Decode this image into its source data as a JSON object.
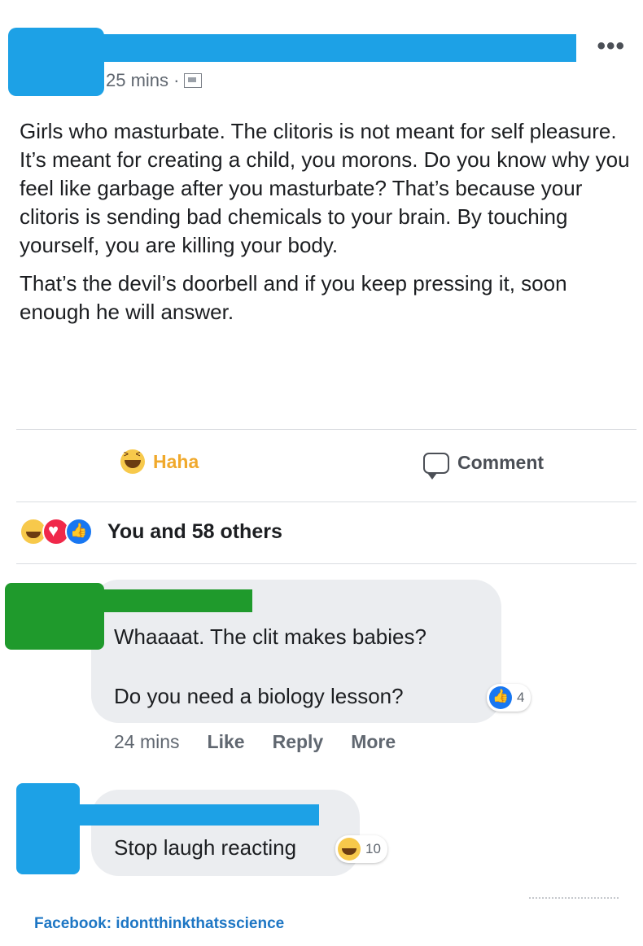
{
  "post": {
    "timestamp": "25 mins ·",
    "privacy_icon": "public-globe-icon",
    "more_icon": "more-dots-icon",
    "paragraphs": [
      "Girls who masturbate. The clitoris is not meant for self pleasure. It’s meant for creating a child, you morons. Do you know why you feel like garbage after you masturbate? That’s because your clitoris is sending bad chemicals to your brain. By touching yourself, you are killing your body.",
      "That’s the devil’s doorbell and if you keep pressing it, soon enough he will answer."
    ]
  },
  "actions": {
    "haha_label": "Haha",
    "comment_label": "Comment"
  },
  "reactions": {
    "summary": "You and 58 others",
    "icons": [
      "haha-icon",
      "love-icon",
      "like-icon"
    ]
  },
  "comments": [
    {
      "lines": [
        "Whaaaat. The clit makes babies?",
        "Do you need a biology lesson?"
      ],
      "reaction_count": "4",
      "time": "24 mins",
      "like": "Like",
      "reply": "Reply",
      "more": "More"
    },
    {
      "lines": [
        "Stop laugh reacting"
      ],
      "reaction_count": "10"
    }
  ],
  "caption": "Facebook: idontthinkthatsscience",
  "colors": {
    "redaction_blue": "#1da1e6",
    "redaction_green": "#1f9a2c",
    "haha": "#f0a92c",
    "like": "#1877f2",
    "caption": "#1d76c4"
  }
}
